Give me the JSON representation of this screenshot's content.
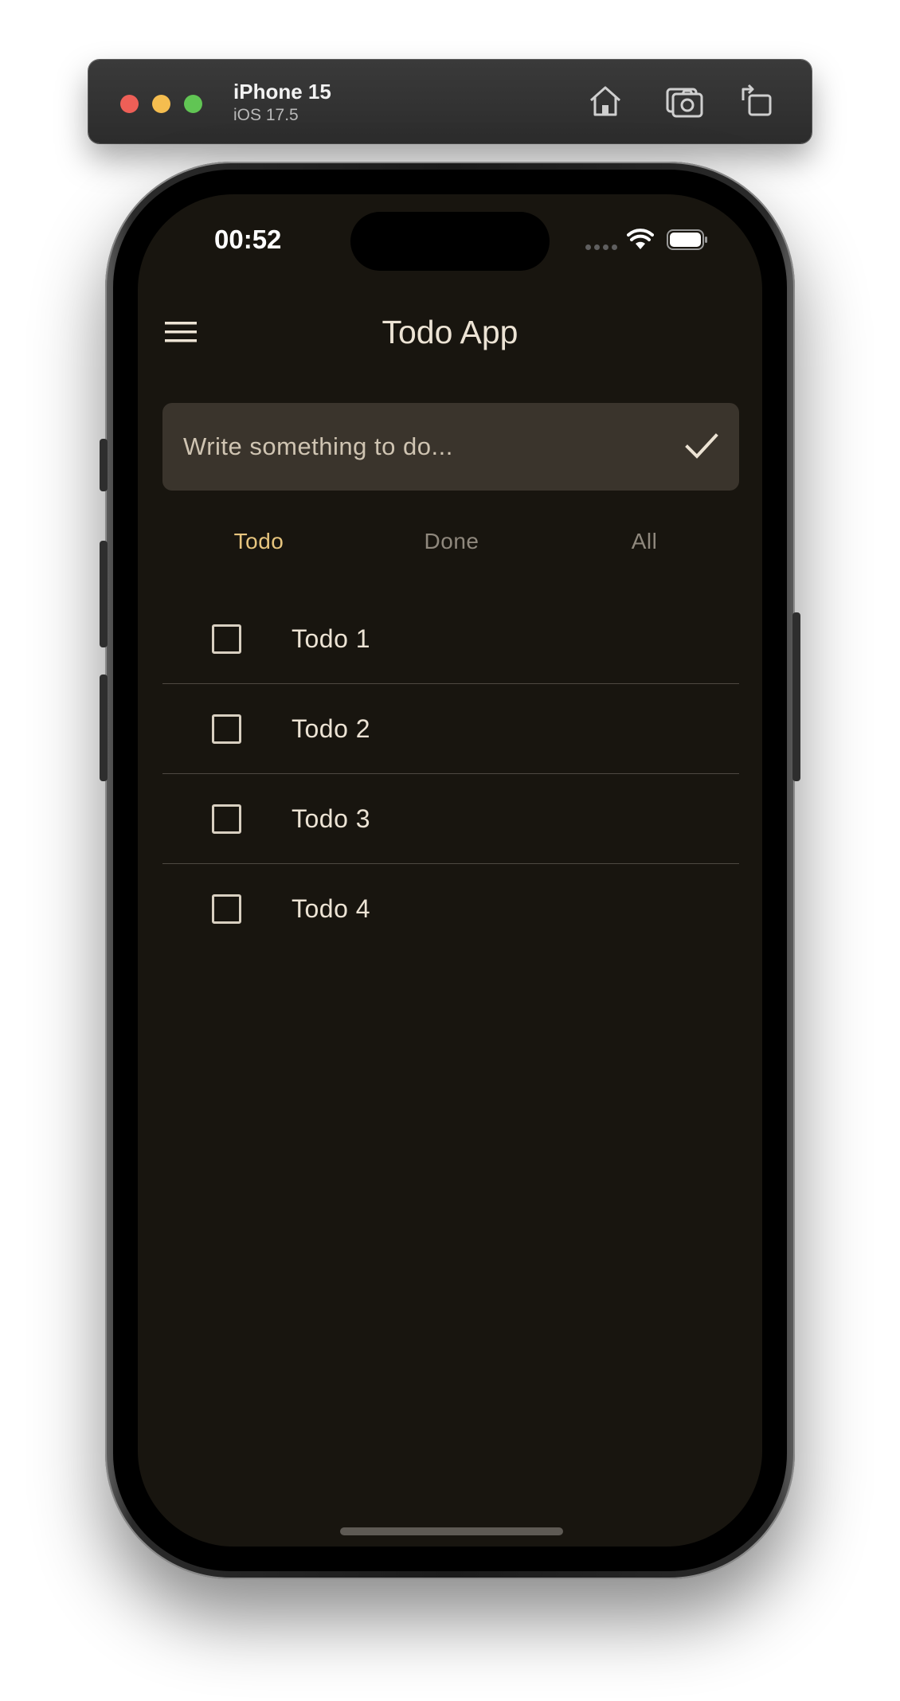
{
  "simulator": {
    "device_name": "iPhone 15",
    "os_version": "iOS 17.5",
    "toolbar_icons": [
      "home-icon",
      "screenshot-icon",
      "rotate-icon"
    ]
  },
  "status_bar": {
    "time": "00:52"
  },
  "app_bar": {
    "title": "Todo App",
    "menu_icon": "hamburger-menu-icon"
  },
  "new_todo": {
    "placeholder": "Write something to do...",
    "value": "",
    "submit_icon": "check-icon"
  },
  "tabs": [
    {
      "label": "Todo",
      "active": true
    },
    {
      "label": "Done",
      "active": false
    },
    {
      "label": "All",
      "active": false
    }
  ],
  "todos": [
    {
      "label": "Todo 1",
      "checked": false
    },
    {
      "label": "Todo 2",
      "checked": false
    },
    {
      "label": "Todo 3",
      "checked": false
    },
    {
      "label": "Todo 4",
      "checked": false
    }
  ],
  "colors": {
    "background": "#18150f",
    "accent": "#e7c57e",
    "text": "#ece3d4",
    "input_background": "#3a342c"
  }
}
